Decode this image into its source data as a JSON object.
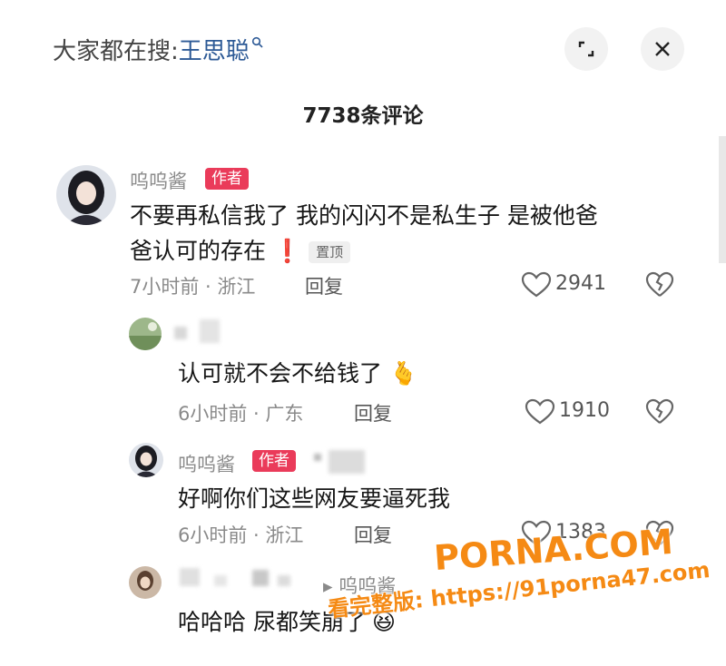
{
  "header": {
    "search_prefix": "大家都在搜:",
    "search_term": "王思聪",
    "comment_count": "7738条评论"
  },
  "comments": [
    {
      "user": "呜呜酱",
      "tag": "作者",
      "text_line1": "不要再私信我了 我的闪闪不是私生子 是被他爸",
      "text_line2": "爸认可的存在",
      "exclaim": "❗",
      "pin": "置顶",
      "meta": "7小时前 · 浙江",
      "reply": "回复",
      "likes": "2941"
    },
    {
      "user": "",
      "text": "认可就不会不给钱了",
      "emoji": "🫰",
      "meta": "6小时前 · 广东",
      "reply": "回复",
      "likes": "1910"
    },
    {
      "user": "呜呜酱",
      "tag": "作者",
      "text": "好啊你们这些网友要逼死我",
      "meta": "6小时前 · 浙江",
      "reply": "回复",
      "likes": "1383"
    },
    {
      "reply_to": "▸ 呜呜酱",
      "text": "哈哈哈 尿都笑崩了",
      "emoji": "😆"
    }
  ],
  "watermark": {
    "brand": "PORNA.COM",
    "url_label": "看完整版:",
    "url": "https://91porna47.com"
  }
}
